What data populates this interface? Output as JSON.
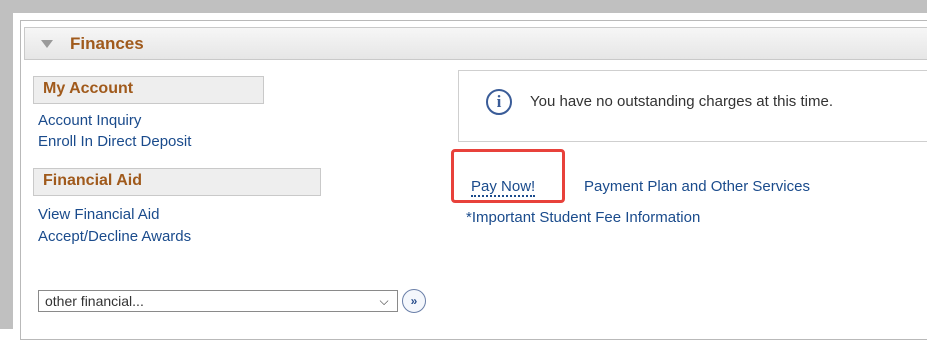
{
  "panel": {
    "title": "Finances"
  },
  "my_account": {
    "header": "My Account",
    "links": [
      "Account Inquiry",
      "Enroll In Direct Deposit"
    ]
  },
  "financial_aid": {
    "header": "Financial Aid",
    "links": [
      "View Financial Aid",
      "Accept/Decline Awards"
    ]
  },
  "other_select": {
    "value": "other financial..."
  },
  "message": {
    "text": "You have no outstanding charges at this time."
  },
  "actions": {
    "pay_now": "Pay Now!",
    "payment_plan": "Payment Plan and Other Services",
    "fee_info": "*Important Student Fee Information"
  },
  "colors": {
    "highlight": "#e8413b",
    "link": "#1a4b8c",
    "section_title": "#a05a1c"
  }
}
